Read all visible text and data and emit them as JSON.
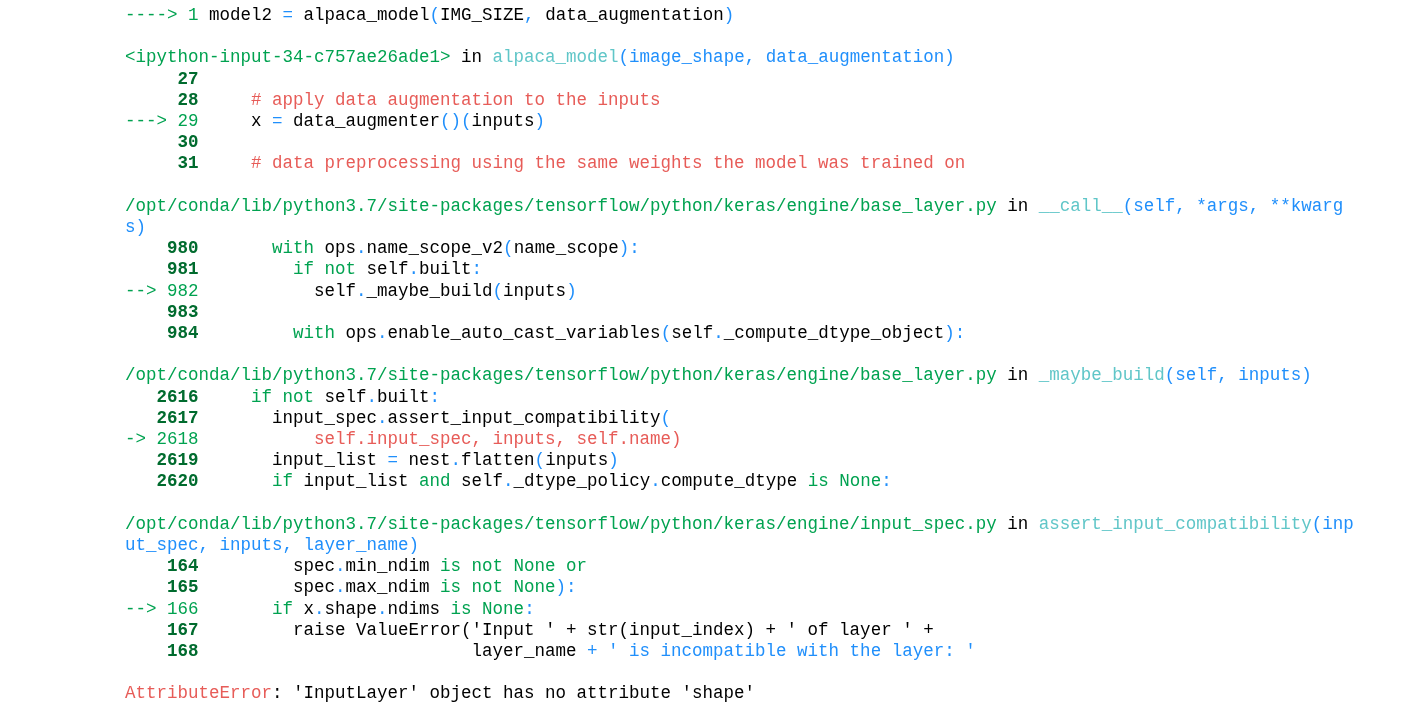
{
  "traceback": [
    {
      "lines": [
        [
          {
            "kind": "arrow",
            "text": "----> 1 "
          },
          {
            "kind": "plain",
            "text": "model2 "
          },
          {
            "kind": "op",
            "text": "="
          },
          {
            "kind": "plain",
            "text": " alpaca_model"
          },
          {
            "kind": "op",
            "text": "("
          },
          {
            "kind": "plain",
            "text": "IMG_SIZE"
          },
          {
            "kind": "op",
            "text": ","
          },
          {
            "kind": "plain",
            "text": " data_augmentation"
          },
          {
            "kind": "op",
            "text": ")"
          }
        ]
      ]
    },
    {
      "lines": [
        [
          {
            "kind": "path",
            "text": "<ipython-input-34-c757ae26ade1>"
          },
          {
            "kind": "plain",
            "text": " in "
          },
          {
            "kind": "func",
            "text": "alpaca_model"
          },
          {
            "kind": "op",
            "text": "(image_shape, data_augmentation)"
          }
        ],
        [
          {
            "kind": "lineno",
            "text": "     27"
          }
        ],
        [
          {
            "kind": "lineno",
            "text": "     28"
          },
          {
            "kind": "comment",
            "text": "     # apply data augmentation to the inputs"
          }
        ],
        [
          {
            "kind": "arrow",
            "text": "---> 29"
          },
          {
            "kind": "plain",
            "text": "     x "
          },
          {
            "kind": "op",
            "text": "="
          },
          {
            "kind": "plain",
            "text": " data_augmenter"
          },
          {
            "kind": "op",
            "text": "()("
          },
          {
            "kind": "plain",
            "text": "inputs"
          },
          {
            "kind": "op",
            "text": ")"
          }
        ],
        [
          {
            "kind": "lineno",
            "text": "     30"
          }
        ],
        [
          {
            "kind": "lineno",
            "text": "     31"
          },
          {
            "kind": "comment",
            "text": "     # data preprocessing using the same weights the model was trained on"
          }
        ]
      ]
    },
    {
      "lines": [
        [
          {
            "kind": "path",
            "text": "/opt/conda/lib/python3.7/site-packages/tensorflow/python/keras/engine/base_layer.py"
          },
          {
            "kind": "plain",
            "text": " in "
          },
          {
            "kind": "func",
            "text": "__call__"
          },
          {
            "kind": "op",
            "text": "(self, *args, **kwarg"
          }
        ],
        [
          {
            "kind": "op",
            "text": "s)"
          }
        ],
        [
          {
            "kind": "lineno",
            "text": "    980"
          },
          {
            "kind": "kw",
            "text": "       with"
          },
          {
            "kind": "plain",
            "text": " ops"
          },
          {
            "kind": "op",
            "text": "."
          },
          {
            "kind": "plain",
            "text": "name_scope_v2"
          },
          {
            "kind": "op",
            "text": "("
          },
          {
            "kind": "plain",
            "text": "name_scope"
          },
          {
            "kind": "op",
            "text": "):"
          }
        ],
        [
          {
            "kind": "lineno",
            "text": "    981"
          },
          {
            "kind": "kw",
            "text": "         if not"
          },
          {
            "kind": "plain",
            "text": " self"
          },
          {
            "kind": "op",
            "text": "."
          },
          {
            "kind": "plain",
            "text": "built"
          },
          {
            "kind": "op",
            "text": ":"
          }
        ],
        [
          {
            "kind": "arrow",
            "text": "--> 982"
          },
          {
            "kind": "plain",
            "text": "           self"
          },
          {
            "kind": "op",
            "text": "."
          },
          {
            "kind": "plain",
            "text": "_maybe_build"
          },
          {
            "kind": "op",
            "text": "("
          },
          {
            "kind": "plain",
            "text": "inputs"
          },
          {
            "kind": "op",
            "text": ")"
          }
        ],
        [
          {
            "kind": "lineno",
            "text": "    983"
          }
        ],
        [
          {
            "kind": "lineno",
            "text": "    984"
          },
          {
            "kind": "kw",
            "text": "         with"
          },
          {
            "kind": "plain",
            "text": " ops"
          },
          {
            "kind": "op",
            "text": "."
          },
          {
            "kind": "plain",
            "text": "enable_auto_cast_variables"
          },
          {
            "kind": "op",
            "text": "("
          },
          {
            "kind": "plain",
            "text": "self"
          },
          {
            "kind": "op",
            "text": "."
          },
          {
            "kind": "plain",
            "text": "_compute_dtype_object"
          },
          {
            "kind": "op",
            "text": "):"
          }
        ]
      ]
    },
    {
      "lines": [
        [
          {
            "kind": "path",
            "text": "/opt/conda/lib/python3.7/site-packages/tensorflow/python/keras/engine/base_layer.py"
          },
          {
            "kind": "plain",
            "text": " in "
          },
          {
            "kind": "func",
            "text": "_maybe_build"
          },
          {
            "kind": "op",
            "text": "(self, inputs)"
          }
        ],
        [
          {
            "kind": "lineno",
            "text": "   2616"
          },
          {
            "kind": "kw",
            "text": "     if not"
          },
          {
            "kind": "plain",
            "text": " self"
          },
          {
            "kind": "op",
            "text": "."
          },
          {
            "kind": "plain",
            "text": "built"
          },
          {
            "kind": "op",
            "text": ":"
          }
        ],
        [
          {
            "kind": "lineno",
            "text": "   2617"
          },
          {
            "kind": "plain",
            "text": "       input_spec"
          },
          {
            "kind": "op",
            "text": "."
          },
          {
            "kind": "plain",
            "text": "assert_input_compatibility"
          },
          {
            "kind": "op",
            "text": "("
          }
        ],
        [
          {
            "kind": "arrow",
            "text": "-> 2618"
          },
          {
            "kind": "comment",
            "text": "           self.input_spec, inputs, self.name)"
          }
        ],
        [
          {
            "kind": "lineno",
            "text": "   2619"
          },
          {
            "kind": "plain",
            "text": "       input_list "
          },
          {
            "kind": "op",
            "text": "="
          },
          {
            "kind": "plain",
            "text": " nest"
          },
          {
            "kind": "op",
            "text": "."
          },
          {
            "kind": "plain",
            "text": "flatten"
          },
          {
            "kind": "op",
            "text": "("
          },
          {
            "kind": "plain",
            "text": "inputs"
          },
          {
            "kind": "op",
            "text": ")"
          }
        ],
        [
          {
            "kind": "lineno",
            "text": "   2620"
          },
          {
            "kind": "kw",
            "text": "       if"
          },
          {
            "kind": "plain",
            "text": " input_list "
          },
          {
            "kind": "kw",
            "text": "and"
          },
          {
            "kind": "plain",
            "text": " self"
          },
          {
            "kind": "op",
            "text": "."
          },
          {
            "kind": "plain",
            "text": "_dtype_policy"
          },
          {
            "kind": "op",
            "text": "."
          },
          {
            "kind": "plain",
            "text": "compute_dtype "
          },
          {
            "kind": "kw",
            "text": "is None"
          },
          {
            "kind": "op",
            "text": ":"
          }
        ]
      ]
    },
    {
      "lines": [
        [
          {
            "kind": "path",
            "text": "/opt/conda/lib/python3.7/site-packages/tensorflow/python/keras/engine/input_spec.py"
          },
          {
            "kind": "plain",
            "text": " in "
          },
          {
            "kind": "func",
            "text": "assert_input_compatibility"
          },
          {
            "kind": "op",
            "text": "(inp"
          }
        ],
        [
          {
            "kind": "op",
            "text": "ut_spec, inputs, layer_name)"
          }
        ],
        [
          {
            "kind": "lineno",
            "text": "    164"
          },
          {
            "kind": "plain",
            "text": "         spec"
          },
          {
            "kind": "op",
            "text": "."
          },
          {
            "kind": "plain",
            "text": "min_ndim "
          },
          {
            "kind": "kw",
            "text": "is not None or"
          }
        ],
        [
          {
            "kind": "lineno",
            "text": "    165"
          },
          {
            "kind": "plain",
            "text": "         spec"
          },
          {
            "kind": "op",
            "text": "."
          },
          {
            "kind": "plain",
            "text": "max_ndim "
          },
          {
            "kind": "kw",
            "text": "is not None"
          },
          {
            "kind": "op",
            "text": "):"
          }
        ],
        [
          {
            "kind": "arrow",
            "text": "--> 166"
          },
          {
            "kind": "kw",
            "text": "       if"
          },
          {
            "kind": "plain",
            "text": " x"
          },
          {
            "kind": "op",
            "text": "."
          },
          {
            "kind": "plain",
            "text": "shape"
          },
          {
            "kind": "op",
            "text": "."
          },
          {
            "kind": "plain",
            "text": "ndims "
          },
          {
            "kind": "kw",
            "text": "is None"
          },
          {
            "kind": "op",
            "text": ":"
          }
        ],
        [
          {
            "kind": "lineno",
            "text": "    167"
          },
          {
            "kind": "plain",
            "text": "         raise ValueError('Input ' + str(input_index) + ' of layer ' +"
          }
        ],
        [
          {
            "kind": "lineno",
            "text": "    168"
          },
          {
            "kind": "plain",
            "text": "                          layer_name"
          },
          {
            "kind": "op",
            "text": " + ' is incompatible with the layer: '"
          }
        ]
      ]
    },
    {
      "lines": [
        [
          {
            "kind": "comment",
            "text": "AttributeError"
          },
          {
            "kind": "plain",
            "text": ": 'InputLayer' object has no attribute 'shape'"
          }
        ]
      ]
    }
  ]
}
